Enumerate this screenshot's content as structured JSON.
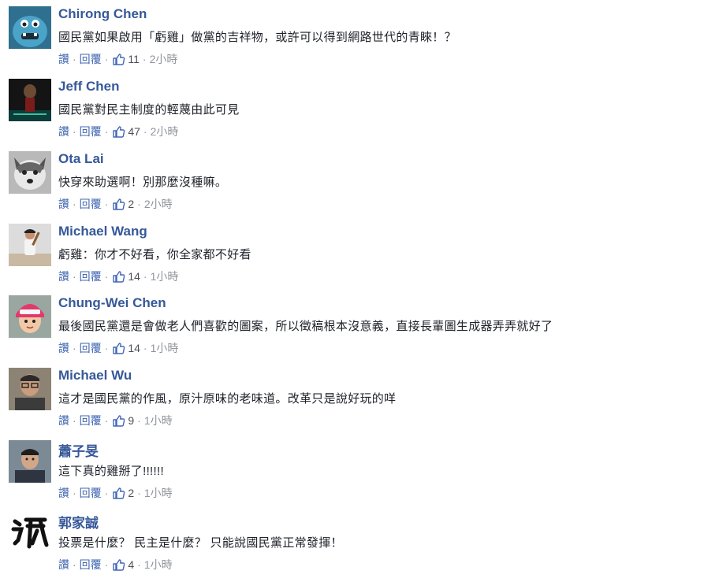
{
  "actions": {
    "like_label": "讚",
    "reply_label": "回覆"
  },
  "comments": [
    {
      "author": "Chirong Chen",
      "text": "國民黨如果啟用「虧雞」做黨的吉祥物，或許可以得到網路世代的青睞！？",
      "likes": "11",
      "time": "2小時",
      "avatar": "blue-monster-avatar"
    },
    {
      "author": "Jeff Chen",
      "text": "國民黨對民主制度的輕蔑由此可見",
      "likes": "47",
      "time": "2小時",
      "avatar": "dark-poster-avatar"
    },
    {
      "author": "Ota Lai",
      "text": "快穿來助選啊！別那麼沒種嘛。",
      "likes": "2",
      "time": "2小時",
      "avatar": "husky-dog-avatar"
    },
    {
      "author": "Michael Wang",
      "text": "虧雞：你才不好看，你全家都不好看",
      "likes": "14",
      "time": "1小時",
      "avatar": "baseball-player-avatar"
    },
    {
      "author": "Chung-Wei Chen",
      "text": "最後國民黨還是會做老人們喜歡的圖案，所以徵稿根本沒意義，直接長輩圖生成器弄弄就好了",
      "likes": "14",
      "time": "1小時",
      "avatar": "child-helmet-avatar"
    },
    {
      "author": "Michael Wu",
      "text": "這才是國民黨的作風，原汁原味的老味道。改革只是說好玩的咩",
      "likes": "9",
      "time": "1小時",
      "avatar": "man-glasses-avatar"
    },
    {
      "author": "蕭子旻",
      "text": "這下真的雞掰了!!!!!!",
      "likes": "2",
      "time": "1小時",
      "avatar": "man-portrait-avatar"
    },
    {
      "author": "郭家誠",
      "text": "投票是什麼？ 民主是什麼？ 只能說國民黨正常發揮！",
      "likes": "4",
      "time": "1小時",
      "avatar": "calligraphy-avatar"
    }
  ]
}
